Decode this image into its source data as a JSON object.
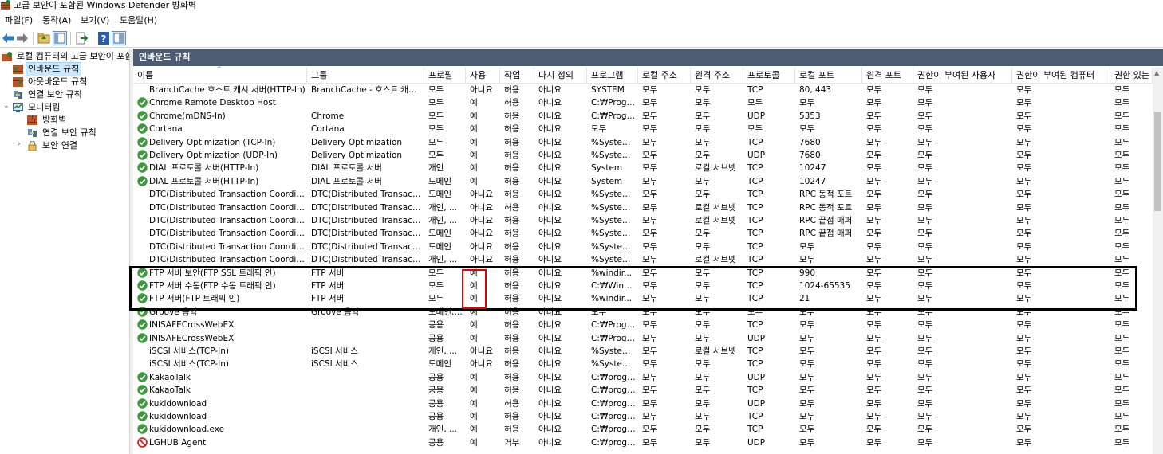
{
  "window": {
    "title": "고급 보안이 포함된 Windows Defender 방화벽"
  },
  "menu": [
    "파일(F)",
    "동작(A)",
    "보기(V)",
    "도움말(H)"
  ],
  "toolbar": [
    "back-icon",
    "forward-icon",
    "up-folder-icon",
    "show-hide-tree-icon",
    "export-list-icon",
    "help-icon",
    "properties-icon"
  ],
  "nav": {
    "root": "로컬 컴퓨터의 고급 보안이 포함된",
    "items": [
      {
        "label": "인바운드 규칙",
        "icon": "inbound-rules-icon",
        "selected": true
      },
      {
        "label": "아웃바운드 규칙",
        "icon": "outbound-rules-icon"
      },
      {
        "label": "연결 보안 규칙",
        "icon": "connection-security-icon"
      },
      {
        "label": "모니터링",
        "icon": "monitoring-icon"
      },
      {
        "label": "방화벽",
        "icon": "firewall-icon"
      },
      {
        "label": "연결 보안 규칙",
        "icon": "connection-security-icon"
      },
      {
        "label": "보안 연결",
        "icon": "lock-icon"
      }
    ]
  },
  "content": {
    "title": "인바운드 규칙"
  },
  "columns": [
    "이름",
    "그룹",
    "프로필",
    "사용",
    "작업",
    "다시 정의",
    "프로그램",
    "로컬 주소",
    "원격 주소",
    "프로토콜",
    "로컬 포트",
    "원격 포트",
    "권한이 부여된 사용자",
    "권한이 부여된 컴퓨터",
    "권한 있는"
  ],
  "rows": [
    {
      "status": "none",
      "cells": [
        "BranchCache 호스트 캐시 서버(HTTP-In)",
        "BranchCache - 호스트 캐시...",
        "모두",
        "아니요",
        "허용",
        "아니요",
        "SYSTEM",
        "모두",
        "모두",
        "TCP",
        "80, 443",
        "모두",
        "모두",
        "모두",
        "모두"
      ]
    },
    {
      "status": "allow",
      "cells": [
        "Chrome Remote Desktop Host",
        "",
        "모두",
        "예",
        "허용",
        "아니요",
        "C:₩Progr...",
        "모두",
        "모두",
        "모두",
        "모두",
        "모두",
        "모두",
        "모두",
        "모두"
      ]
    },
    {
      "status": "allow",
      "cells": [
        "Chrome(mDNS-In)",
        "Chrome",
        "모두",
        "예",
        "허용",
        "아니요",
        "C:₩Progr...",
        "모두",
        "모두",
        "UDP",
        "5353",
        "모두",
        "모두",
        "모두",
        "모두"
      ]
    },
    {
      "status": "allow",
      "cells": [
        "Cortana",
        "Cortana",
        "모두",
        "예",
        "허용",
        "아니요",
        "모두",
        "모두",
        "모두",
        "모두",
        "모두",
        "모두",
        "모두",
        "모두",
        "모두"
      ]
    },
    {
      "status": "allow",
      "cells": [
        "Delivery Optimization (TCP-In)",
        "Delivery Optimization",
        "모두",
        "예",
        "허용",
        "아니요",
        "%System...",
        "모두",
        "모두",
        "TCP",
        "7680",
        "모두",
        "모두",
        "모두",
        "모두"
      ]
    },
    {
      "status": "allow",
      "cells": [
        "Delivery Optimization (UDP-In)",
        "Delivery Optimization",
        "모두",
        "예",
        "허용",
        "아니요",
        "%System...",
        "모두",
        "모두",
        "UDP",
        "7680",
        "모두",
        "모두",
        "모두",
        "모두"
      ]
    },
    {
      "status": "allow",
      "cells": [
        "DIAL 프로토콜 서버(HTTP-In)",
        "DIAL 프로토콜 서버",
        "개인",
        "예",
        "허용",
        "아니요",
        "System",
        "모두",
        "로컬 서브넷",
        "TCP",
        "10247",
        "모두",
        "모두",
        "모두",
        "모두"
      ]
    },
    {
      "status": "allow",
      "cells": [
        "DIAL 프로토콜 서버(HTTP-In)",
        "DIAL 프로토콜 서버",
        "도메인",
        "예",
        "허용",
        "아니요",
        "System",
        "모두",
        "모두",
        "TCP",
        "10247",
        "모두",
        "모두",
        "모두",
        "모두"
      ]
    },
    {
      "status": "none",
      "cells": [
        "DTC(Distributed Transaction Coordinato...",
        "DTC(Distributed Transactio...",
        "도메인",
        "아니요",
        "허용",
        "아니요",
        "%System...",
        "모두",
        "모두",
        "TCP",
        "RPC 동적 포트",
        "모두",
        "모두",
        "모두",
        "모두"
      ]
    },
    {
      "status": "none",
      "cells": [
        "DTC(Distributed Transaction Coordinato...",
        "DTC(Distributed Transactio...",
        "개인, ...",
        "아니요",
        "허용",
        "아니요",
        "%System...",
        "모두",
        "로컬 서브넷",
        "TCP",
        "RPC 동적 포트",
        "모두",
        "모두",
        "모두",
        "모두"
      ]
    },
    {
      "status": "none",
      "cells": [
        "DTC(Distributed Transaction Coordinato...",
        "DTC(Distributed Transactio...",
        "개인, ...",
        "아니요",
        "허용",
        "아니요",
        "%System...",
        "모두",
        "로컬 서브넷",
        "TCP",
        "RPC 끝점 매퍼",
        "모두",
        "모두",
        "모두",
        "모두"
      ]
    },
    {
      "status": "none",
      "cells": [
        "DTC(Distributed Transaction Coordinato...",
        "DTC(Distributed Transactio...",
        "도메인",
        "아니요",
        "허용",
        "아니요",
        "%System...",
        "모두",
        "모두",
        "TCP",
        "RPC 끝점 매퍼",
        "모두",
        "모두",
        "모두",
        "모두"
      ]
    },
    {
      "status": "none",
      "cells": [
        "DTC(Distributed Transaction Coordinato...",
        "DTC(Distributed Transactio...",
        "도메인",
        "아니요",
        "허용",
        "아니요",
        "%System...",
        "모두",
        "모두",
        "TCP",
        "모두",
        "모두",
        "모두",
        "모두",
        "모두"
      ]
    },
    {
      "status": "none",
      "cells": [
        "DTC(Distributed Transaction Coordinato...",
        "DTC(Distributed Transactio...",
        "개인, ...",
        "아니요",
        "허용",
        "아니요",
        "%System...",
        "모두",
        "로컬 서브넷",
        "TCP",
        "모두",
        "모두",
        "모두",
        "모두",
        "모두"
      ]
    },
    {
      "status": "allow",
      "cells": [
        "FTP 서버 보안(FTP SSL 트래픽 인)",
        "FTP 서버",
        "모두",
        "예",
        "허용",
        "아니요",
        "%windir...",
        "모두",
        "모두",
        "TCP",
        "990",
        "모두",
        "모두",
        "모두",
        "모두"
      ]
    },
    {
      "status": "allow",
      "cells": [
        "FTP 서버 수동(FTP 수동 트래픽 인)",
        "FTP 서버",
        "모두",
        "예",
        "허용",
        "아니요",
        "C:₩Wind...",
        "모두",
        "모두",
        "TCP",
        "1024-65535",
        "모두",
        "모두",
        "모두",
        "모두"
      ]
    },
    {
      "status": "allow",
      "cells": [
        "FTP 서버(FTP 트래픽 인)",
        "FTP 서버",
        "모두",
        "예",
        "허용",
        "아니요",
        "%windir...",
        "모두",
        "모두",
        "TCP",
        "21",
        "모두",
        "모두",
        "모두",
        "모두"
      ]
    },
    {
      "status": "allow",
      "cells": [
        "Groove 음악",
        "Groove 음악",
        "도메인, ...",
        "예",
        "허용",
        "아니요",
        "모두",
        "모두",
        "모두",
        "모두",
        "모두",
        "모두",
        "모두",
        "모두",
        "모두"
      ]
    },
    {
      "status": "allow",
      "cells": [
        "INISAFECrossWebEX",
        "",
        "공용",
        "예",
        "허용",
        "아니요",
        "C:₩Progr...",
        "모두",
        "모두",
        "TCP",
        "모두",
        "모두",
        "모두",
        "모두",
        "모두"
      ]
    },
    {
      "status": "allow",
      "cells": [
        "INISAFECrossWebEX",
        "",
        "공용",
        "예",
        "허용",
        "아니요",
        "C:₩Progr...",
        "모두",
        "모두",
        "UDP",
        "모두",
        "모두",
        "모두",
        "모두",
        "모두"
      ]
    },
    {
      "status": "none",
      "cells": [
        "iSCSI 서비스(TCP-In)",
        "iSCSI 서비스",
        "개인, ...",
        "아니요",
        "허용",
        "아니요",
        "%System...",
        "모두",
        "로컬 서브넷",
        "TCP",
        "모두",
        "모두",
        "모두",
        "모두",
        "모두"
      ]
    },
    {
      "status": "none",
      "cells": [
        "iSCSI 서비스(TCP-In)",
        "iSCSI 서비스",
        "도메인",
        "아니요",
        "허용",
        "아니요",
        "%System...",
        "모두",
        "모두",
        "TCP",
        "모두",
        "모두",
        "모두",
        "모두",
        "모두"
      ]
    },
    {
      "status": "allow",
      "cells": [
        "KakaoTalk",
        "",
        "공용",
        "예",
        "허용",
        "아니요",
        "C:₩progr...",
        "모두",
        "모두",
        "UDP",
        "모두",
        "모두",
        "모두",
        "모두",
        "모두"
      ]
    },
    {
      "status": "allow",
      "cells": [
        "KakaoTalk",
        "",
        "공용",
        "예",
        "허용",
        "아니요",
        "C:₩progr...",
        "모두",
        "모두",
        "TCP",
        "모두",
        "모두",
        "모두",
        "모두",
        "모두"
      ]
    },
    {
      "status": "allow",
      "cells": [
        "kukidownload",
        "",
        "공용",
        "예",
        "허용",
        "아니요",
        "C:₩progr...",
        "모두",
        "모두",
        "UDP",
        "모두",
        "모두",
        "모두",
        "모두",
        "모두"
      ]
    },
    {
      "status": "allow",
      "cells": [
        "kukidownload",
        "",
        "공용",
        "예",
        "허용",
        "아니요",
        "C:₩progr...",
        "모두",
        "모두",
        "TCP",
        "모두",
        "모두",
        "모두",
        "모두",
        "모두"
      ]
    },
    {
      "status": "allow",
      "cells": [
        "kukidownload.exe",
        "",
        "개인, ...",
        "예",
        "허용",
        "아니요",
        "C:₩progr...",
        "모두",
        "모두",
        "TCP",
        "모두",
        "모두",
        "모두",
        "모두",
        "모두"
      ]
    },
    {
      "status": "block",
      "cells": [
        "LGHUB Agent",
        "",
        "공용",
        "예",
        "거부",
        "아니요",
        "C:₩progr...",
        "모두",
        "모두",
        "UDP",
        "모두",
        "모두",
        "모두",
        "모두",
        "모두"
      ]
    }
  ],
  "colors": {
    "header_bar": "#4d5b73",
    "selection": "#cce8ff",
    "allow_green": "#3a9a3a",
    "block_red": "#d42020",
    "highlight_red": "#e00000",
    "highlight_black": "#000000"
  }
}
